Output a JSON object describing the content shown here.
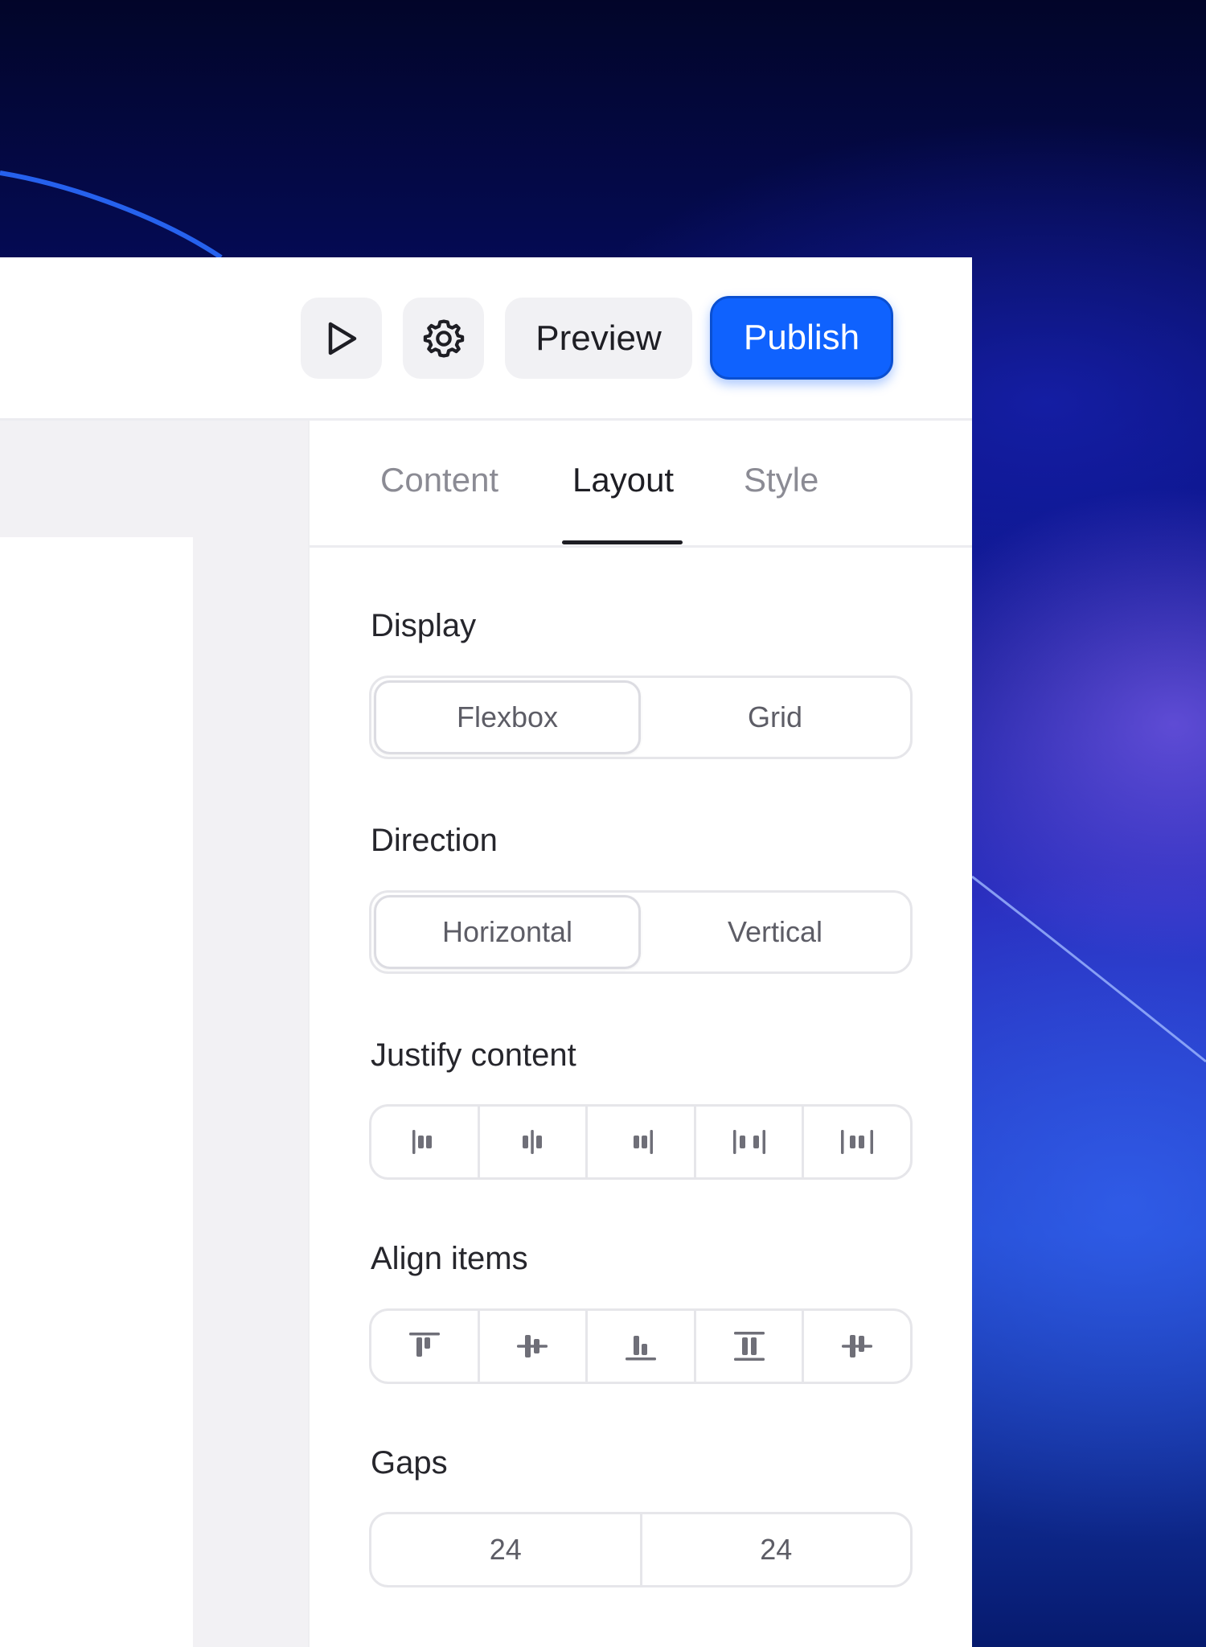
{
  "toolbar": {
    "play_icon": "play-icon",
    "settings_icon": "gear-icon",
    "preview_label": "Preview",
    "publish_label": "Publish",
    "publish_color": "#0f62fe"
  },
  "panel": {
    "tabs": [
      {
        "label": "Content",
        "active": false
      },
      {
        "label": "Layout",
        "active": true
      },
      {
        "label": "Style",
        "active": false
      }
    ],
    "display": {
      "label": "Display",
      "options": [
        "Flexbox",
        "Grid"
      ],
      "selected": "Flexbox"
    },
    "direction": {
      "label": "Direction",
      "options": [
        "Horizontal",
        "Vertical"
      ],
      "selected": "Horizontal"
    },
    "justify": {
      "label": "Justify content",
      "icons": [
        "justify-start-icon",
        "justify-center-icon",
        "justify-end-icon",
        "justify-space-between-icon",
        "justify-space-around-icon"
      ]
    },
    "align": {
      "label": "Align items",
      "icons": [
        "align-top-icon",
        "align-center-icon",
        "align-bottom-icon",
        "align-stretch-icon",
        "align-baseline-icon"
      ]
    },
    "gaps": {
      "label": "Gaps",
      "values": [
        "24",
        "24"
      ]
    }
  }
}
